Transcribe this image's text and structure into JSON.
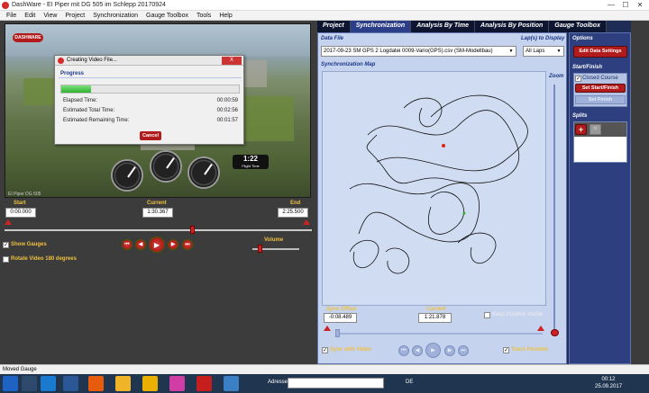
{
  "window": {
    "title": "DashWare - EI Piper mit DG 505 im Schlepp 20170924",
    "min": "—",
    "max": "☐",
    "close": "✕"
  },
  "menu": [
    "File",
    "Edit",
    "View",
    "Project",
    "Synchronization",
    "Gauge Toolbox",
    "Tools",
    "Help"
  ],
  "video": {
    "logo": "DASHWARE",
    "flight_time": "1:22",
    "flight_time_label": "Flight Time",
    "watermark": "EI Piper DG 505"
  },
  "dialog": {
    "title": "Creating Video File...",
    "close_label": "X",
    "section": "Progress",
    "progress_percent": 17,
    "elapsed_label": "Elapsed Time:",
    "elapsed_value": "00:00:59",
    "total_label": "Estimated Total Time:",
    "total_value": "00:02:56",
    "remaining_label": "Estimated Remaining Time:",
    "remaining_value": "00:01:57",
    "cancel_label": "Cancel"
  },
  "timeline": {
    "start_label": "Start",
    "start_value": "0:00.000",
    "current_label": "Current",
    "current_value": "1:30.367",
    "end_label": "End",
    "end_value": "2:25.500",
    "position_percent": 61
  },
  "options": {
    "show_gauges": "Show Gauges",
    "show_gauges_checked": "✓",
    "rotate": "Rotate Video 180 degrees"
  },
  "playback": {
    "first": "⏮",
    "prev": "◀",
    "play": "▶",
    "next": "▶",
    "last": "⏭"
  },
  "volume": {
    "label": "Volume",
    "level_percent": 15
  },
  "tabs": [
    "Project",
    "Synchronization",
    "Analysis By Time",
    "Analysis By Position",
    "Gauge Toolbox"
  ],
  "sync": {
    "data_file_label": "Data File",
    "data_file_value": "2017-09-23 SM GPS 2 Logdatei 0009-Vario(GPS).csv (SM-Modellbau)",
    "laps_label": "Lap(s) to Display",
    "laps_value": "All Laps",
    "map_label": "Synchronization Map",
    "zoom_label": "Zoom",
    "sync_offset_label": "Sync Offset",
    "sync_offset_value": "-0:08.489",
    "current_label": "Current",
    "current_value": "1:21.878",
    "keep_position_visible": "Keep Position Visible",
    "sync_with_video": "Sync with Video",
    "sync_with_video_checked": "✓",
    "track_position": "Track Position",
    "track_position_checked": "✓"
  },
  "options_panel": {
    "options_label": "Options",
    "edit_data_settings": "Edit Data Settings",
    "start_finish_label": "Start/Finish",
    "closed_course": "Closed Course",
    "closed_course_checked": "✓",
    "set_start_finish": "Set Start/Finish",
    "set_finish": "Set Finish",
    "splits_label": "Splits",
    "add_split": "+",
    "remove_split": "✕"
  },
  "status": {
    "text": "Moved Gauge"
  },
  "taskbar": {
    "address_label": "Adresse",
    "lang": "DE",
    "time": "00:12",
    "date": "25.09.2017"
  }
}
